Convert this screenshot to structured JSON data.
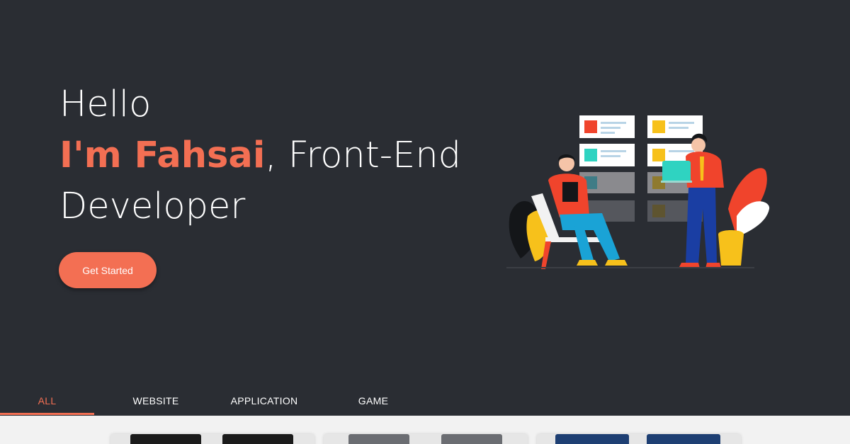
{
  "hero": {
    "greeting": "Hello",
    "name": "I'm Fahsai",
    "role_line1": ", Front-End",
    "role_line2": "Developer",
    "cta_label": "Get Started"
  },
  "tabs": [
    {
      "label": "ALL",
      "active": true
    },
    {
      "label": "WEBSITE",
      "active": false
    },
    {
      "label": "APPLICATION",
      "active": false
    },
    {
      "label": "GAME",
      "active": false
    }
  ],
  "colors": {
    "background": "#2a2d33",
    "accent": "#f36f53",
    "gallery_bg": "#f2f2f2"
  }
}
